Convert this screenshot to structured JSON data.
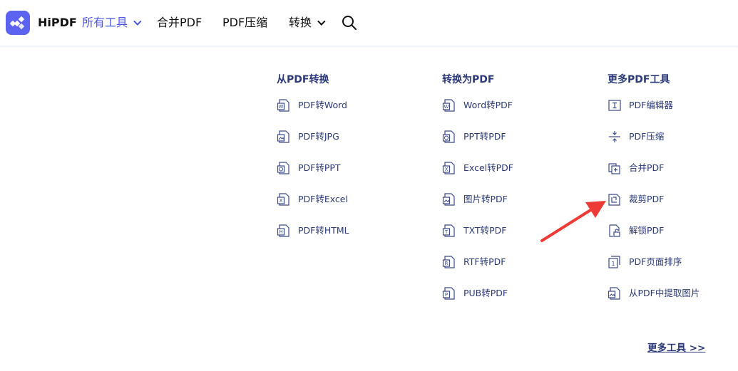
{
  "header": {
    "brand": "HiPDF",
    "nav": [
      {
        "label": "所有工具",
        "dropdown": true,
        "active": true
      },
      {
        "label": "合并PDF",
        "dropdown": false,
        "active": false
      },
      {
        "label": "PDF压缩",
        "dropdown": false,
        "active": false
      },
      {
        "label": "转换",
        "dropdown": true,
        "active": false
      }
    ],
    "search_icon": "search-icon"
  },
  "menu": {
    "from_pdf": {
      "title": "从PDF转换",
      "items": [
        {
          "label": "PDF转Word",
          "icon": "word-doc-icon",
          "badge": "W"
        },
        {
          "label": "PDF转JPG",
          "icon": "image-doc-icon",
          "badge": "img"
        },
        {
          "label": "PDF转PPT",
          "icon": "ppt-doc-icon",
          "badge": "P"
        },
        {
          "label": "PDF转Excel",
          "icon": "excel-doc-icon",
          "badge": "X"
        },
        {
          "label": "PDF转HTML",
          "icon": "html-doc-icon",
          "badge": "H"
        }
      ]
    },
    "to_pdf": {
      "title": "转换为PDF",
      "items": [
        {
          "label": "Word转PDF",
          "icon": "word-doc-icon",
          "badge": "W"
        },
        {
          "label": "PPT转PDF",
          "icon": "ppt-doc-icon",
          "badge": "P"
        },
        {
          "label": "Excel转PDF",
          "icon": "excel-doc-icon",
          "badge": "X"
        },
        {
          "label": "图片转PDF",
          "icon": "image-doc-icon",
          "badge": "img"
        },
        {
          "label": "TXT转PDF",
          "icon": "txt-doc-icon",
          "badge": "T"
        },
        {
          "label": "RTF转PDF",
          "icon": "rtf-doc-icon",
          "badge": "R"
        },
        {
          "label": "PUB转PDF",
          "icon": "pub-doc-icon",
          "badge": "P"
        }
      ]
    },
    "more_tools": {
      "title": "更多PDF工具",
      "items": [
        {
          "label": "PDF编辑器",
          "icon": "text-cursor-icon",
          "badge": "I"
        },
        {
          "label": "PDF压缩",
          "icon": "compress-icon",
          "badge": ""
        },
        {
          "label": "合并PDF",
          "icon": "merge-icon",
          "badge": "+"
        },
        {
          "label": "裁剪PDF",
          "icon": "crop-icon",
          "badge": "crop"
        },
        {
          "label": "解锁PDF",
          "icon": "unlock-icon",
          "badge": "lock"
        },
        {
          "label": "PDF页面排序",
          "icon": "page-order-icon",
          "badge": "1"
        },
        {
          "label": "从PDF中提取图片",
          "icon": "extract-image-icon",
          "badge": "img"
        }
      ]
    },
    "more_link": "更多工具 >>"
  },
  "colors": {
    "accent": "#4b55e8",
    "logo": "#5b63f0",
    "menu_text": "#2c3a7a",
    "icon_stroke": "#3a4a8c",
    "annotation_arrow": "#ef3b36"
  }
}
